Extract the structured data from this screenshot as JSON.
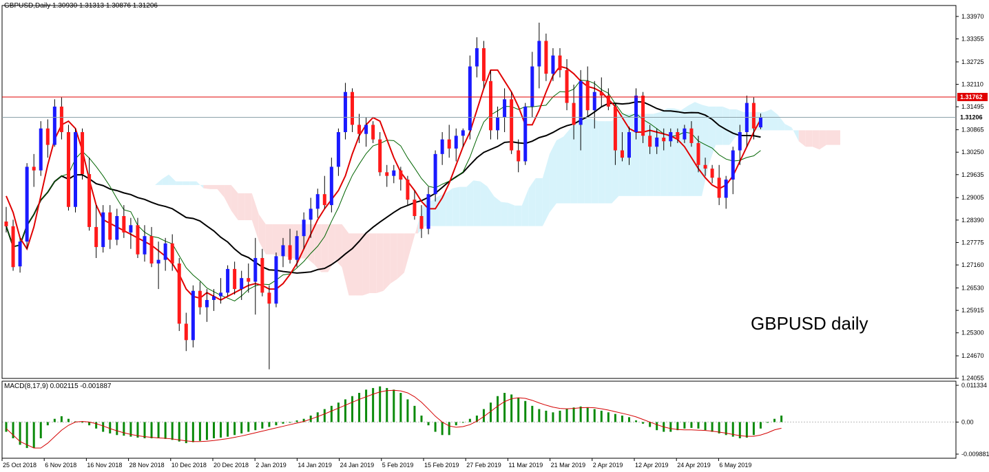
{
  "header": {
    "symbol_text": "GBPUSD,Daily  1.30930 1.31313 1.30876 1.31206"
  },
  "annotation": {
    "text": "GBPUSD daily"
  },
  "macd": {
    "label": "MACD(8,17,9) 0.002115 -0.001887"
  },
  "colors": {
    "bull": "#1a1aff",
    "bear": "#ff1a1a",
    "ma_fast": "#e00000",
    "ma_mid": "#006400",
    "ma_slow": "#000000",
    "cloud_bull": "#d7f3fb",
    "cloud_bear": "#fbdede",
    "macd_hist": "#0a8a0a",
    "macd_signal": "#d40000",
    "level": "#e00000"
  },
  "chart_data": [
    {
      "type": "candlestick",
      "title": "GBPUSD,Daily",
      "ylim": [
        1.2405,
        1.3427
      ],
      "y_ticks": [
        "1.33970",
        "1.33355",
        "1.32725",
        "1.32110",
        "1.31495",
        "1.30865",
        "1.30250",
        "1.29635",
        "1.29005",
        "1.28390",
        "1.27775",
        "1.27160",
        "1.26530",
        "1.25915",
        "1.25300",
        "1.24670",
        "1.24055"
      ],
      "x_ticks": [
        "25 Oct 2018",
        "6 Nov 2018",
        "16 Nov 2018",
        "28 Nov 2018",
        "10 Dec 2018",
        "20 Dec 2018",
        "2 Jan 2019",
        "14 Jan 2019",
        "24 Jan 2019",
        "5 Feb 2019",
        "15 Feb 2019",
        "27 Feb 2019",
        "11 Mar 2019",
        "21 Mar 2019",
        "2 Apr 2019",
        "12 Apr 2019",
        "24 Apr 2019",
        "6 May 2019"
      ],
      "price_labels": {
        "resistance": "1.31762",
        "current": "1.31206"
      },
      "candles_ohlc": [
        [
          1.2835,
          1.2875,
          1.2805,
          1.2822
        ],
        [
          1.2822,
          1.284,
          1.27,
          1.271
        ],
        [
          1.2712,
          1.279,
          1.2695,
          1.278
        ],
        [
          1.278,
          1.2995,
          1.276,
          1.2985
        ],
        [
          1.2985,
          1.302,
          1.293,
          1.2975
        ],
        [
          1.2975,
          1.311,
          1.296,
          1.309
        ],
        [
          1.309,
          1.3115,
          1.301,
          1.3045
        ],
        [
          1.3045,
          1.317,
          1.304,
          1.315
        ],
        [
          1.315,
          1.3175,
          1.306,
          1.308
        ],
        [
          1.308,
          1.31,
          1.2865,
          1.2875
        ],
        [
          1.2875,
          1.309,
          1.286,
          1.308
        ],
        [
          1.308,
          1.309,
          1.295,
          1.2965
        ],
        [
          1.2965,
          1.301,
          1.281,
          1.282
        ],
        [
          1.282,
          1.288,
          1.2735,
          1.2765
        ],
        [
          1.2765,
          1.288,
          1.275,
          1.286
        ],
        [
          1.286,
          1.288,
          1.276,
          1.2785
        ],
        [
          1.2785,
          1.287,
          1.277,
          1.285
        ],
        [
          1.285,
          1.288,
          1.279,
          1.2805
        ],
        [
          1.2805,
          1.2845,
          1.276,
          1.2825
        ],
        [
          1.2825,
          1.2845,
          1.2735,
          1.2745
        ],
        [
          1.2745,
          1.2825,
          1.2725,
          1.2795
        ],
        [
          1.2795,
          1.282,
          1.271,
          1.272
        ],
        [
          1.272,
          1.278,
          1.265,
          1.273
        ],
        [
          1.273,
          1.279,
          1.27,
          1.2775
        ],
        [
          1.2775,
          1.28,
          1.27,
          1.272
        ],
        [
          1.272,
          1.2735,
          1.2535,
          1.2555
        ],
        [
          1.2555,
          1.2585,
          1.248,
          1.251
        ],
        [
          1.251,
          1.266,
          1.249,
          1.2645
        ],
        [
          1.2645,
          1.267,
          1.258,
          1.26
        ],
        [
          1.26,
          1.265,
          1.256,
          1.262
        ],
        [
          1.262,
          1.265,
          1.259,
          1.263
        ],
        [
          1.263,
          1.268,
          1.261,
          1.264
        ],
        [
          1.264,
          1.2715,
          1.263,
          1.2705
        ],
        [
          1.2705,
          1.2725,
          1.2635,
          1.265
        ],
        [
          1.265,
          1.27,
          1.262,
          1.268
        ],
        [
          1.268,
          1.272,
          1.264,
          1.267
        ],
        [
          1.267,
          1.279,
          1.258,
          1.2735
        ],
        [
          1.2735,
          1.276,
          1.263,
          1.264
        ],
        [
          1.264,
          1.266,
          1.243,
          1.261
        ],
        [
          1.261,
          1.275,
          1.26,
          1.274
        ],
        [
          1.274,
          1.279,
          1.271,
          1.277
        ],
        [
          1.277,
          1.2815,
          1.272,
          1.273
        ],
        [
          1.273,
          1.281,
          1.271,
          1.2795
        ],
        [
          1.2795,
          1.286,
          1.276,
          1.284
        ],
        [
          1.284,
          1.29,
          1.279,
          1.287
        ],
        [
          1.287,
          1.2925,
          1.2845,
          1.291
        ],
        [
          1.291,
          1.296,
          1.287,
          1.288
        ],
        [
          1.288,
          1.301,
          1.286,
          1.2985
        ],
        [
          1.2985,
          1.309,
          1.296,
          1.308
        ],
        [
          1.308,
          1.3215,
          1.306,
          1.319
        ],
        [
          1.319,
          1.32,
          1.308,
          1.31
        ],
        [
          1.31,
          1.313,
          1.305,
          1.3075
        ],
        [
          1.3075,
          1.312,
          1.304,
          1.31
        ],
        [
          1.31,
          1.311,
          1.305,
          1.306
        ],
        [
          1.306,
          1.308,
          1.296,
          1.297
        ],
        [
          1.297,
          1.299,
          1.293,
          1.296
        ],
        [
          1.296,
          1.299,
          1.294,
          1.2975
        ],
        [
          1.2975,
          1.2985,
          1.292,
          1.295
        ],
        [
          1.295,
          1.296,
          1.288,
          1.2895
        ],
        [
          1.2895,
          1.292,
          1.284,
          1.285
        ],
        [
          1.285,
          1.288,
          1.279,
          1.2815
        ],
        [
          1.2815,
          1.293,
          1.28,
          1.291
        ],
        [
          1.291,
          1.303,
          1.289,
          1.302
        ],
        [
          1.302,
          1.308,
          1.299,
          1.306
        ],
        [
          1.306,
          1.31,
          1.301,
          1.3035
        ],
        [
          1.3035,
          1.309,
          1.3,
          1.307
        ],
        [
          1.307,
          1.309,
          1.304,
          1.3085
        ],
        [
          1.3085,
          1.329,
          1.306,
          1.326
        ],
        [
          1.326,
          1.334,
          1.323,
          1.331
        ],
        [
          1.331,
          1.333,
          1.32,
          1.322
        ],
        [
          1.322,
          1.325,
          1.306,
          1.3085
        ],
        [
          1.3085,
          1.315,
          1.306,
          1.312
        ],
        [
          1.312,
          1.32,
          1.308,
          1.317
        ],
        [
          1.317,
          1.319,
          1.302,
          1.303
        ],
        [
          1.303,
          1.306,
          1.297,
          1.3
        ],
        [
          1.3,
          1.316,
          1.299,
          1.315
        ],
        [
          1.315,
          1.33,
          1.312,
          1.326
        ],
        [
          1.326,
          1.338,
          1.32,
          1.333
        ],
        [
          1.333,
          1.335,
          1.322,
          1.324
        ],
        [
          1.324,
          1.331,
          1.322,
          1.329
        ],
        [
          1.329,
          1.331,
          1.323,
          1.325
        ],
        [
          1.325,
          1.328,
          1.314,
          1.316
        ],
        [
          1.316,
          1.321,
          1.306,
          1.31
        ],
        [
          1.31,
          1.325,
          1.303,
          1.322
        ],
        [
          1.322,
          1.326,
          1.312,
          1.314
        ],
        [
          1.314,
          1.322,
          1.309,
          1.319
        ],
        [
          1.319,
          1.323,
          1.315,
          1.318
        ],
        [
          1.318,
          1.32,
          1.314,
          1.315
        ],
        [
          1.315,
          1.316,
          1.299,
          1.303
        ],
        [
          1.303,
          1.308,
          1.3,
          1.301
        ],
        [
          1.301,
          1.3095,
          1.299,
          1.308
        ],
        [
          1.308,
          1.32,
          1.306,
          1.318
        ],
        [
          1.318,
          1.319,
          1.305,
          1.307
        ],
        [
          1.307,
          1.31,
          1.302,
          1.304
        ],
        [
          1.304,
          1.309,
          1.302,
          1.3065
        ],
        [
          1.3065,
          1.309,
          1.303,
          1.3055
        ],
        [
          1.3055,
          1.309,
          1.304,
          1.308
        ],
        [
          1.308,
          1.309,
          1.305,
          1.306
        ],
        [
          1.306,
          1.31,
          1.305,
          1.309
        ],
        [
          1.309,
          1.311,
          1.304,
          1.305
        ],
        [
          1.305,
          1.307,
          1.297,
          1.299
        ],
        [
          1.299,
          1.301,
          1.296,
          1.298
        ],
        [
          1.298,
          1.299,
          1.294,
          1.2955
        ],
        [
          1.2955,
          1.299,
          1.288,
          1.29
        ],
        [
          1.29,
          1.296,
          1.287,
          1.295
        ],
        [
          1.295,
          1.304,
          1.291,
          1.303
        ],
        [
          1.303,
          1.31,
          1.299,
          1.308
        ],
        [
          1.308,
          1.318,
          1.304,
          1.316
        ],
        [
          1.316,
          1.3175,
          1.306,
          1.309
        ],
        [
          1.3093,
          1.3131,
          1.3088,
          1.3121
        ]
      ],
      "ma_fast_series": [
        1.2905,
        1.286,
        1.279,
        1.276,
        1.282,
        1.2905,
        1.299,
        1.306,
        1.31,
        1.311,
        1.309,
        1.303,
        1.295,
        1.288,
        1.284,
        1.283,
        1.282,
        1.281,
        1.28,
        1.279,
        1.278,
        1.277,
        1.2755,
        1.274,
        1.272,
        1.269,
        1.265,
        1.263,
        1.2625,
        1.264,
        1.263,
        1.262,
        1.263,
        1.264,
        1.265,
        1.266,
        1.2665,
        1.266,
        1.265,
        1.265,
        1.2665,
        1.269,
        1.272,
        1.276,
        1.28,
        1.284,
        1.287,
        1.2895,
        1.292,
        1.296,
        1.302,
        1.307,
        1.31,
        1.312,
        1.311,
        1.306,
        1.301,
        1.297,
        1.2945,
        1.292,
        1.289,
        1.287,
        1.287,
        1.29,
        1.294,
        1.299,
        1.304,
        1.308,
        1.314,
        1.32,
        1.325,
        1.325,
        1.322,
        1.319,
        1.315,
        1.31,
        1.31,
        1.314,
        1.319,
        1.3235,
        1.326,
        1.3255,
        1.324,
        1.322,
        1.3205,
        1.32,
        1.319,
        1.317,
        1.315,
        1.312,
        1.309,
        1.308,
        1.308,
        1.3085,
        1.308,
        1.3075,
        1.307,
        1.306,
        1.304,
        1.301,
        1.298,
        1.2955,
        1.2935,
        1.2925,
        1.2935,
        1.296,
        1.3,
        1.304,
        1.308,
        1.3115
      ]
    },
    {
      "type": "bar",
      "title": "MACD(8,17,9)",
      "ylim": [
        -0.009881,
        0.011334
      ],
      "y_ticks": [
        "0.011334",
        "0.00",
        "-0.009881"
      ],
      "values_legend": {
        "macd": "0.002115",
        "signal": "-0.001887"
      },
      "histogram": [
        -0.003,
        -0.005,
        -0.007,
        -0.008,
        -0.008,
        -0.005,
        -0.001,
        0.001,
        0.0018,
        0.001,
        0.0002,
        0.0,
        -0.001,
        -0.002,
        -0.003,
        -0.0035,
        -0.004,
        -0.0042,
        -0.0045,
        -0.0048,
        -0.005,
        -0.005,
        -0.005,
        -0.0052,
        -0.0055,
        -0.006,
        -0.0065,
        -0.0062,
        -0.0058,
        -0.0055,
        -0.005,
        -0.0048,
        -0.0045,
        -0.004,
        -0.0035,
        -0.003,
        -0.0025,
        -0.002,
        -0.0015,
        -0.001,
        -0.0005,
        0.0,
        0.0005,
        0.001,
        0.002,
        0.003,
        0.004,
        0.005,
        0.006,
        0.007,
        0.008,
        0.009,
        0.01,
        0.0105,
        0.011,
        0.0105,
        0.01,
        0.009,
        0.007,
        0.005,
        0.002,
        -0.001,
        -0.003,
        -0.004,
        -0.004,
        -0.001,
        0.0,
        0.001,
        0.002,
        0.004,
        0.006,
        0.008,
        0.009,
        0.0085,
        0.0075,
        0.0065,
        0.005,
        0.004,
        0.0035,
        0.003,
        0.0035,
        0.004,
        0.0045,
        0.0048,
        0.0045,
        0.004,
        0.0035,
        0.003,
        0.0025,
        0.002,
        0.0015,
        0.0005,
        -0.0005,
        -0.0015,
        -0.0025,
        -0.003,
        -0.003,
        -0.0025,
        -0.002,
        -0.0018,
        -0.002,
        -0.0025,
        -0.003,
        -0.0035,
        -0.004,
        -0.0045,
        -0.005,
        -0.0048,
        -0.004,
        -0.002,
        0.0,
        0.001,
        0.002
      ],
      "signal": [
        -0.002,
        -0.004,
        -0.006,
        -0.007,
        -0.008,
        -0.008,
        -0.0065,
        -0.0045,
        -0.0025,
        -0.001,
        0.0,
        0.0002,
        0.0,
        -0.0005,
        -0.0012,
        -0.002,
        -0.0027,
        -0.0033,
        -0.0038,
        -0.0042,
        -0.0045,
        -0.0047,
        -0.0049,
        -0.005,
        -0.0052,
        -0.0055,
        -0.0058,
        -0.006,
        -0.006,
        -0.0059,
        -0.0057,
        -0.0054,
        -0.0051,
        -0.0047,
        -0.0043,
        -0.0038,
        -0.0033,
        -0.0028,
        -0.0023,
        -0.0018,
        -0.0013,
        -0.0008,
        -0.0003,
        0.0002,
        0.0009,
        0.0017,
        0.0025,
        0.0034,
        0.0043,
        0.0052,
        0.0061,
        0.007,
        0.0078,
        0.0086,
        0.0093,
        0.0097,
        0.0098,
        0.0096,
        0.009,
        0.0078,
        0.0061,
        0.004,
        0.0018,
        0.0,
        -0.0012,
        -0.0016,
        -0.0014,
        -0.0008,
        0.0003,
        0.0017,
        0.0033,
        0.0049,
        0.0063,
        0.0072,
        0.0075,
        0.0073,
        0.0067,
        0.0059,
        0.0052,
        0.0046,
        0.0042,
        0.0041,
        0.0042,
        0.0044,
        0.0045,
        0.0044,
        0.0041,
        0.0037,
        0.0032,
        0.0027,
        0.0022,
        0.0016,
        0.0008,
        0.0,
        -0.0008,
        -0.0015,
        -0.002,
        -0.0023,
        -0.0024,
        -0.0024,
        -0.0025,
        -0.0026,
        -0.0028,
        -0.0031,
        -0.0034,
        -0.0038,
        -0.0042,
        -0.0044,
        -0.0044,
        -0.004,
        -0.0033,
        -0.0024,
        -0.0019
      ]
    }
  ]
}
